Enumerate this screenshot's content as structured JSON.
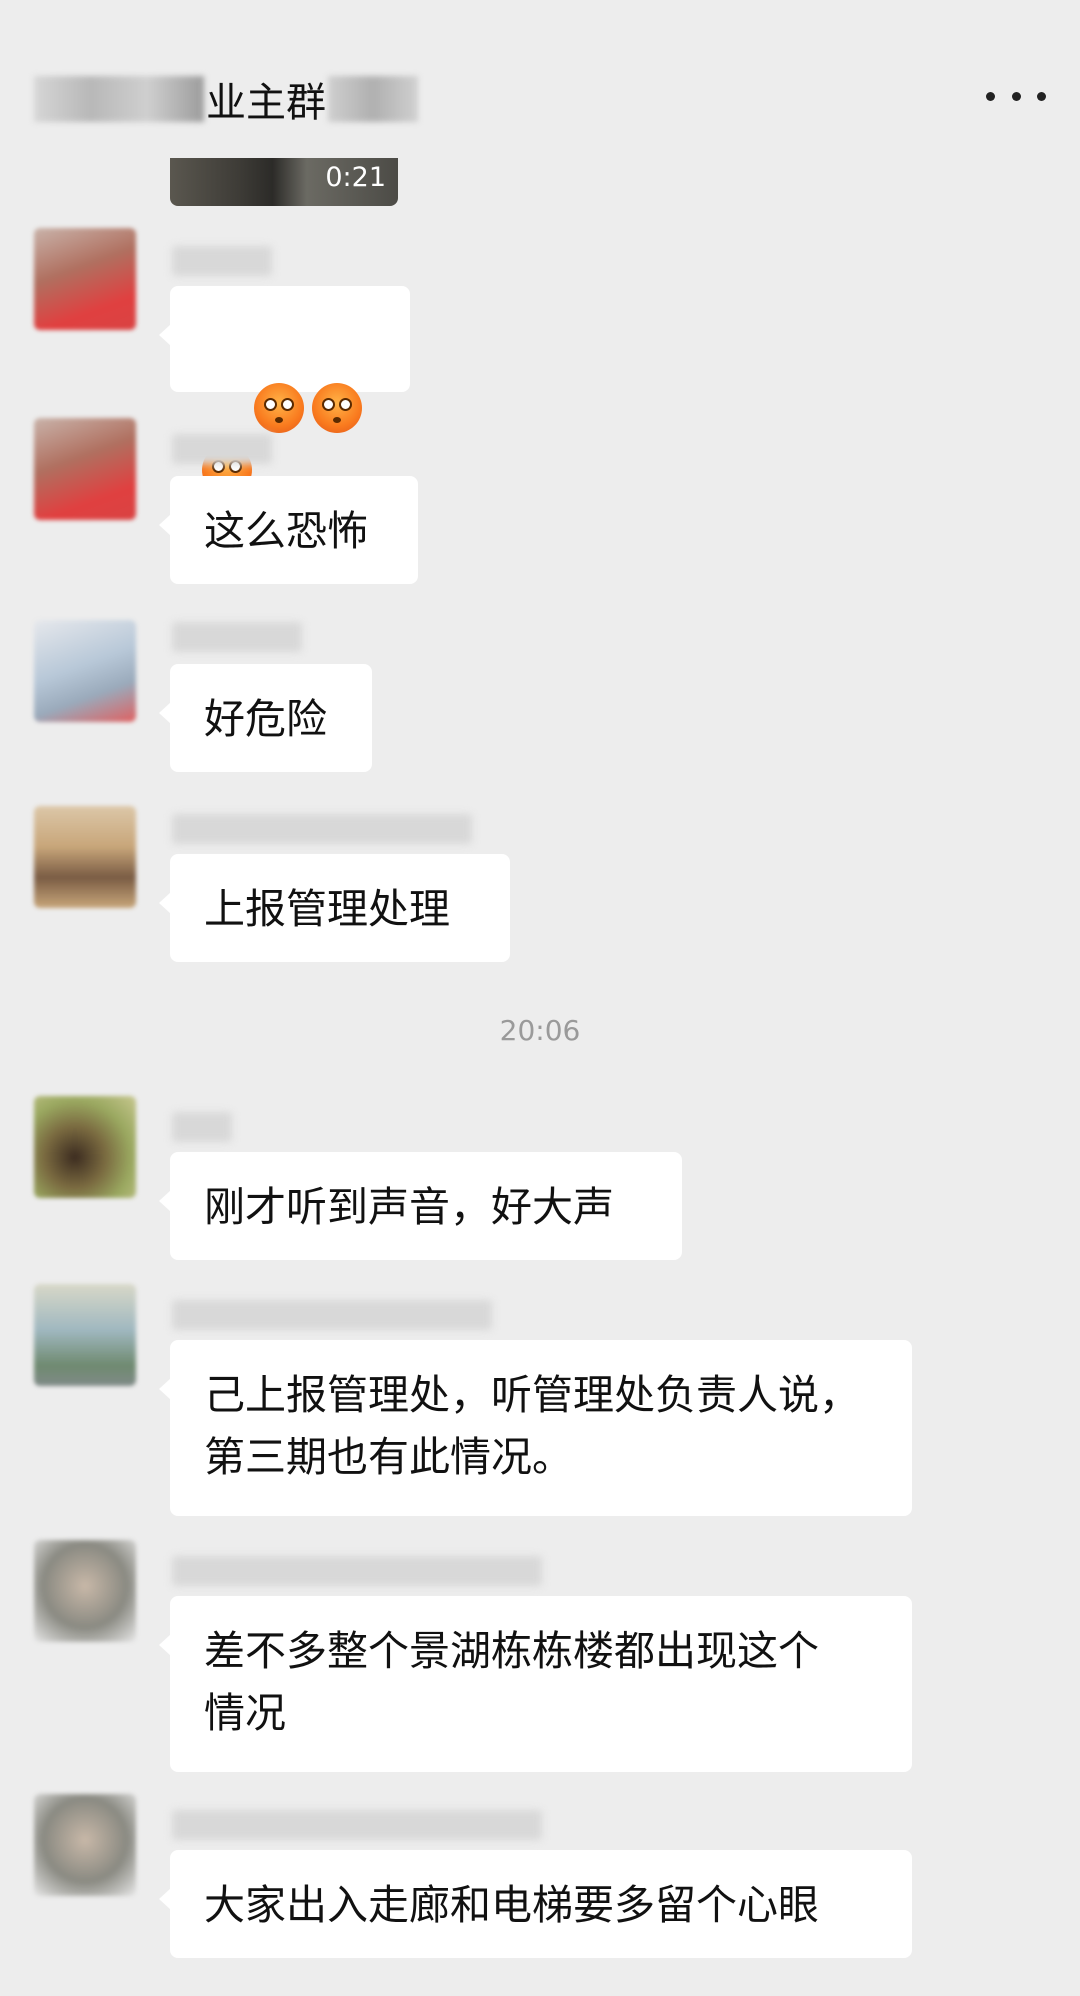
{
  "header": {
    "title_visible": "业主群",
    "more_icon": "more-dots-icon"
  },
  "video": {
    "duration": "0:21"
  },
  "messages": [
    {
      "text": "",
      "emojis": 3,
      "avatar_colors": [
        "#b07060",
        "#e04040",
        "#d9b9b0"
      ]
    },
    {
      "text": "这么恐怖",
      "avatar_colors": [
        "#b07060",
        "#e04040",
        "#d9b9b0"
      ]
    },
    {
      "text": "好危险",
      "avatar_colors": [
        "#b8c8d8",
        "#e06060",
        "#e6e8ec"
      ]
    },
    {
      "text": "上报管理处理",
      "avatar_colors": [
        "#c8a67a",
        "#7a5c44",
        "#dcc7a8"
      ]
    },
    {
      "text": "刚才听到声音，好大声",
      "avatar_colors": [
        "#9aa860",
        "#3c2c20",
        "#c8c890"
      ]
    },
    {
      "text": "己上报管理处，听管理处负责人说，\n第三期也有此情况。",
      "avatar_colors": [
        "#a0b8c0",
        "#6f8a70",
        "#d8d8c8"
      ]
    },
    {
      "text": "差不多整个景湖栋栋楼都出现这个\n情况",
      "avatar_colors": [
        "#8a8a82",
        "#c8b8a8",
        "#e8e8e8"
      ]
    },
    {
      "text": "大家出入走廊和电梯要多留个心眼",
      "avatar_colors": [
        "#8a8a82",
        "#c8b8a8",
        "#e8e8e8"
      ]
    }
  ],
  "timestamp": "20:06",
  "colors": {
    "background": "#ededed",
    "bubble": "#ffffff",
    "text": "#111111",
    "timestamp": "#9a9a9a"
  }
}
